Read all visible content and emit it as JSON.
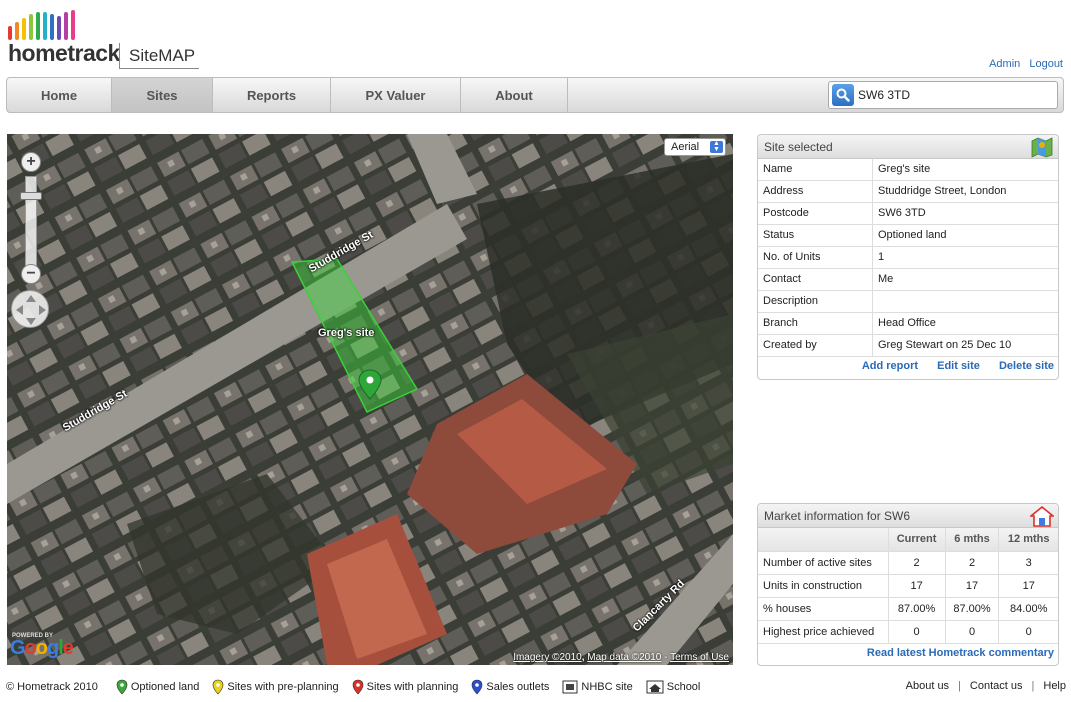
{
  "header": {
    "logo_text": "hometrack",
    "product": "SiteMAP",
    "logo_bar_colors": [
      "#e53a2e",
      "#f08a24",
      "#f5c100",
      "#8cc63f",
      "#2eaa4f",
      "#23b2c8",
      "#2e6fc7",
      "#6c4bb7",
      "#b440a5",
      "#e83e8c"
    ],
    "admin_link": "Admin",
    "logout_link": "Logout"
  },
  "nav": {
    "items": [
      {
        "label": "Home"
      },
      {
        "label": "Sites",
        "active": true
      },
      {
        "label": "Reports"
      },
      {
        "label": "PX Valuer"
      },
      {
        "label": "About"
      }
    ]
  },
  "search": {
    "value": "SW6 3TD"
  },
  "map": {
    "type_select": "Aerial",
    "streets": [
      "Studdridge St",
      "Studdridge St",
      "Clancarty Rd"
    ],
    "site_label": "Greg's site",
    "google": "Google",
    "powered_by": "POWERED BY",
    "attribution": {
      "imagery": "Imagery ©2010",
      "map_data": "Map data ©2010",
      "terms": "Terms of Use",
      "sep": ","
    }
  },
  "site_selected": {
    "title": "Site selected",
    "rows": [
      {
        "label": "Name",
        "value": "Greg's site"
      },
      {
        "label": "Address",
        "value": "Studdridge Street, London"
      },
      {
        "label": "Postcode",
        "value": "SW6 3TD"
      },
      {
        "label": "Status",
        "value": "Optioned land"
      },
      {
        "label": "No. of Units",
        "value": "1"
      },
      {
        "label": "Contact",
        "value": "Me"
      },
      {
        "label": "Description",
        "value": ""
      },
      {
        "label": "Branch",
        "value": "Head Office"
      },
      {
        "label": "Created by",
        "value": "Greg Stewart on 25 Dec 10"
      }
    ],
    "actions": {
      "add_report": "Add report",
      "edit_site": "Edit site",
      "delete_site": "Delete site"
    }
  },
  "market": {
    "title": "Market information for SW6",
    "columns": [
      "",
      "Current",
      "6 mths",
      "12 mths"
    ],
    "rows": [
      {
        "label": "Number of active sites",
        "values": [
          "2",
          "2",
          "3"
        ]
      },
      {
        "label": "Units in construction",
        "values": [
          "17",
          "17",
          "17"
        ]
      },
      {
        "label": "% houses",
        "values": [
          "87.00%",
          "87.00%",
          "84.00%"
        ]
      },
      {
        "label": "Highest price achieved",
        "values": [
          "0",
          "0",
          "0"
        ]
      }
    ],
    "commentary_link": "Read latest Hometrack commentary"
  },
  "footer": {
    "copyright": "© Hometrack 2010",
    "legend": [
      {
        "label": "Optioned land",
        "icon": "green-pin-icon",
        "color": "#3aa83a"
      },
      {
        "label": "Sites with pre-planning",
        "icon": "yellow-pin-icon",
        "color": "#e8d21c"
      },
      {
        "label": "Sites with planning",
        "icon": "red-pin-icon",
        "color": "#d8322a"
      },
      {
        "label": "Sales outlets",
        "icon": "blue-pin-icon",
        "color": "#2a4ed0"
      },
      {
        "label": "NHBC site",
        "icon": "nhbc-icon"
      },
      {
        "label": "School",
        "icon": "school-icon"
      }
    ],
    "links": {
      "about": "About us",
      "contact": "Contact us",
      "help": "Help",
      "sep": "|"
    }
  }
}
